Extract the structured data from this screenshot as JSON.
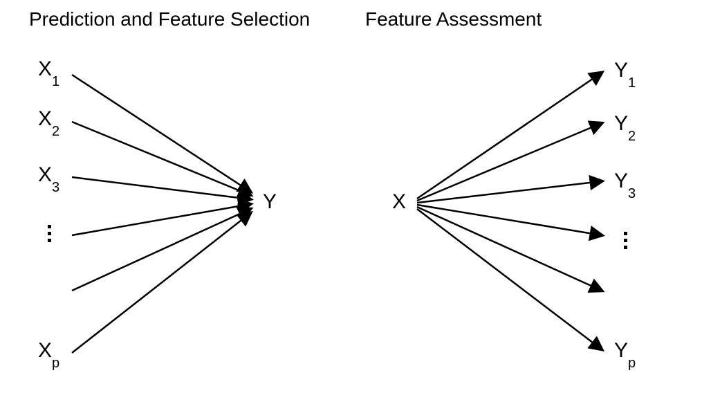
{
  "left": {
    "title": "Prediction and Feature Selection",
    "sources": [
      "X",
      "X",
      "X",
      "X"
    ],
    "sourceSubs": [
      "1",
      "2",
      "3",
      "p"
    ],
    "target": "Y"
  },
  "right": {
    "title": "Feature Assessment",
    "source": "X",
    "targets": [
      "Y",
      "Y",
      "Y",
      "Y"
    ],
    "targetSubs": [
      "1",
      "2",
      "3",
      "p"
    ]
  },
  "ellipsis": "⋮"
}
